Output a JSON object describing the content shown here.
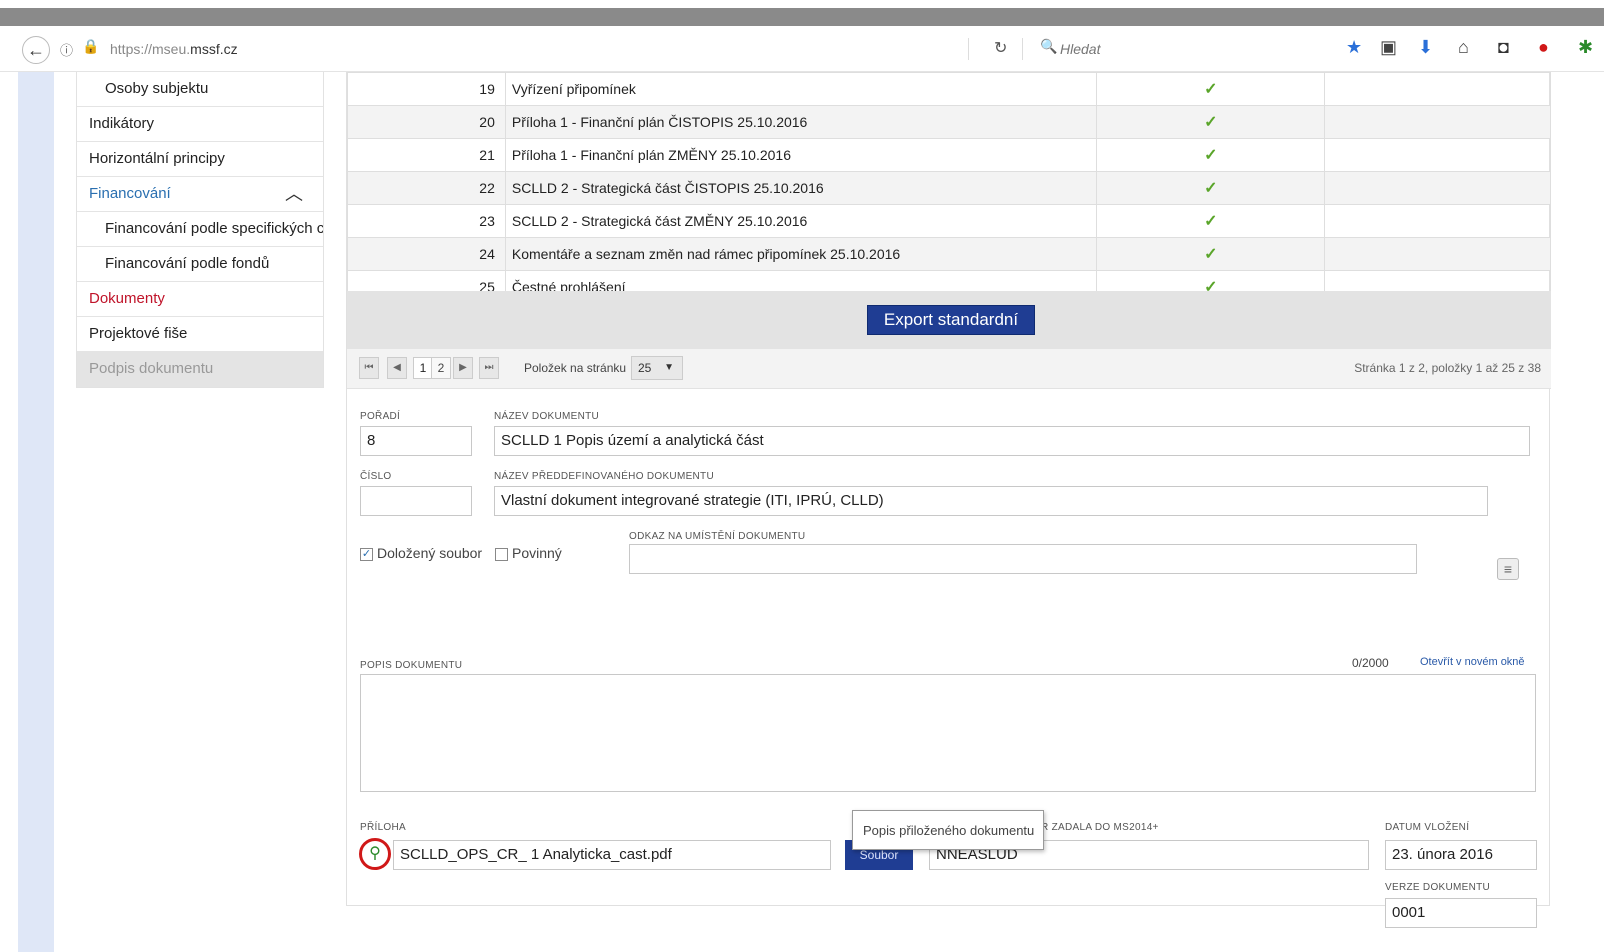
{
  "browser": {
    "url_prefix": "https://mseu.",
    "url_domain": "mssf.cz",
    "search_placeholder": "Hledat",
    "icons": [
      "star-icon",
      "clipboard-icon",
      "download-icon",
      "home-icon",
      "pocket-icon",
      "adblock-icon",
      "extension-icon"
    ]
  },
  "sidebar": {
    "items": [
      {
        "label": "Osoby subjektu",
        "style": "sub"
      },
      {
        "label": "Indikátory",
        "style": ""
      },
      {
        "label": "Horizontální principy",
        "style": ""
      },
      {
        "label": "Financování",
        "style": "blue"
      },
      {
        "label": "Financování podle specifických cílů",
        "style": "sub"
      },
      {
        "label": "Financování podle fondů",
        "style": "sub"
      },
      {
        "label": "Dokumenty",
        "style": "red"
      },
      {
        "label": "Projektové fiše",
        "style": ""
      },
      {
        "label": "Podpis dokumentu",
        "style": "grey"
      }
    ]
  },
  "table": {
    "rows": [
      {
        "num": "19",
        "name": "Vyřízení připomínek",
        "check": "✓"
      },
      {
        "num": "20",
        "name": "Příloha 1 - Finanční plán ČISTOPIS 25.10.2016",
        "check": "✓"
      },
      {
        "num": "21",
        "name": "Příloha 1 - Finanční plán ZMĚNY 25.10.2016",
        "check": "✓"
      },
      {
        "num": "22",
        "name": "SCLLD 2 - Strategická část ČISTOPIS 25.10.2016",
        "check": "✓"
      },
      {
        "num": "23",
        "name": "SCLLD 2 - Strategická část ZMĚNY 25.10.2016",
        "check": "✓"
      },
      {
        "num": "24",
        "name": "Komentáře a seznam změn nad rámec připomínek 25.10.2016",
        "check": "✓"
      },
      {
        "num": "25",
        "name": "Čestné prohlášení",
        "check": "✓"
      }
    ],
    "export_label": "Export standardní"
  },
  "pager": {
    "first": "⏮",
    "prev": "◀",
    "page1": "1",
    "page2": "2",
    "next": "▶",
    "last": "⏭",
    "per_page_label": "Položek na stránku",
    "per_page_value": "25",
    "info": "Stránka 1 z 2, položky 1 až 25 z 38"
  },
  "form": {
    "poradi_label": "Pořadí",
    "poradi_value": "8",
    "nazev_label": "Název dokumentu",
    "nazev_value": "SCLLD 1 Popis území a analytická část",
    "cislo_label": "Číslo",
    "cislo_value": "",
    "predef_label": "Název předdefinovaného dokumentu",
    "predef_value": "Vlastní dokument integrované strategie (ITI, IPRÚ, CLLD)",
    "odkaz_label": "Odkaz na umístění dokumentu",
    "odkaz_value": "",
    "dolozeny_label": "Doložený soubor",
    "povinny_label": "Povinný",
    "popis_label": "Popis dokumentu",
    "counter": "0/2000",
    "new_window": "Otevřít v novém okně",
    "priloha_label": "Příloha",
    "priloha_value": "SCLLD_OPS_CR_ 1 Analyticka_cast.pdf",
    "soubor_label": "Soubor",
    "zadal_label": "R ZADALA DO MS2014+",
    "zadal_value": "NNEASLUD",
    "datum_label": "Datum vložení",
    "datum_value": "23. února 2016",
    "verze_label": "Verze dokumentu",
    "verze_value": "0001",
    "tooltip": "Popis přiloženého dokumentu"
  }
}
